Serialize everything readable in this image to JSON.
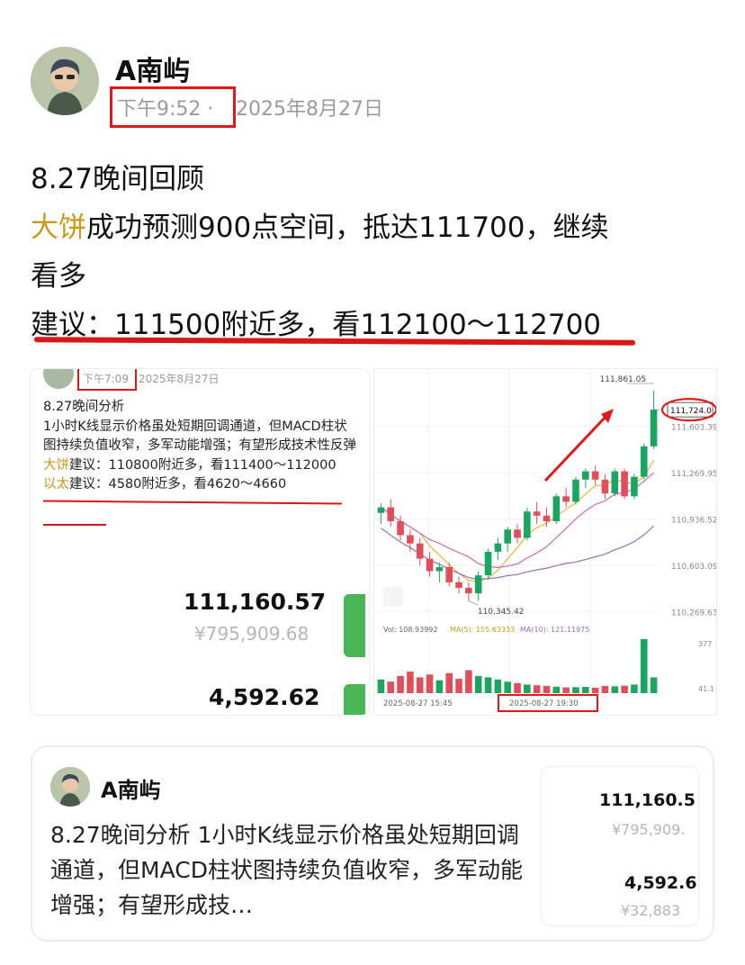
{
  "author": {
    "name": "A南屿"
  },
  "post_meta": {
    "time": "下午9:52",
    "separator": "·",
    "date": "2025年8月27日"
  },
  "post": {
    "line1": "8.27晚间回顾",
    "line2_highlight": "大饼",
    "line2_rest": "成功预测900点空间，抵达111700，继续",
    "line3": "看多",
    "line4": "建议：111500附近多，看112100～112700"
  },
  "embedded_left": {
    "time": "下午7:09",
    "date": "2025年8月27日",
    "title": "8.27晚间分析",
    "body": "1小时K线显示价格虽处短期回调通道，但MACD柱状图持续负值收窄，多军动能增强；有望形成技术性反弹",
    "btc_label": "大饼",
    "btc_advice": "建议：110800附近多，看111400～112000",
    "eth_label": "以太",
    "eth_advice": "建议：4580附近多，看4620～4660",
    "price1": "111,160.57",
    "price1_cny": "¥795,909.68",
    "price2": "4,592.62"
  },
  "chart_data": {
    "type": "candlestick",
    "price_axis_labels": [
      "111,603.39",
      "111,269.95",
      "110,936.52",
      "110,603.09",
      "110,269.63"
    ],
    "high_label": "111,861.05",
    "low_label": "110,345.42",
    "last_price_label": "111,724.0",
    "volume_info": {
      "vol": "Vol: 108.93992",
      "ma5": "MA(5): 155.63333",
      "ma10": "MA(10): 121.11975"
    },
    "volume_axis_labels": [
      "377",
      "41.1"
    ],
    "time_labels": [
      "2025-08-27 15:45",
      "2025-08-27 19:30"
    ],
    "candles": [
      {
        "o": 110980,
        "h": 111050,
        "l": 110900,
        "c": 111020
      },
      {
        "o": 111020,
        "h": 111080,
        "l": 110880,
        "c": 110920
      },
      {
        "o": 110920,
        "h": 110960,
        "l": 110780,
        "c": 110820
      },
      {
        "o": 110820,
        "h": 110860,
        "l": 110700,
        "c": 110760
      },
      {
        "o": 110760,
        "h": 110800,
        "l": 110600,
        "c": 110650
      },
      {
        "o": 110650,
        "h": 110700,
        "l": 110520,
        "c": 110560
      },
      {
        "o": 110560,
        "h": 110620,
        "l": 110480,
        "c": 110590
      },
      {
        "o": 110590,
        "h": 110620,
        "l": 110450,
        "c": 110480
      },
      {
        "o": 110480,
        "h": 110520,
        "l": 110400,
        "c": 110440
      },
      {
        "o": 110440,
        "h": 110480,
        "l": 110345,
        "c": 110400
      },
      {
        "o": 110400,
        "h": 110560,
        "l": 110345,
        "c": 110530
      },
      {
        "o": 110530,
        "h": 110720,
        "l": 110500,
        "c": 110700
      },
      {
        "o": 110700,
        "h": 110800,
        "l": 110640,
        "c": 110760
      },
      {
        "o": 110760,
        "h": 110880,
        "l": 110700,
        "c": 110860
      },
      {
        "o": 110860,
        "h": 110900,
        "l": 110760,
        "c": 110800
      },
      {
        "o": 110800,
        "h": 111020,
        "l": 110780,
        "c": 110990
      },
      {
        "o": 110990,
        "h": 111060,
        "l": 110900,
        "c": 110960
      },
      {
        "o": 110960,
        "h": 111020,
        "l": 110880,
        "c": 110920
      },
      {
        "o": 110920,
        "h": 111120,
        "l": 110900,
        "c": 111100
      },
      {
        "o": 111100,
        "h": 111160,
        "l": 111020,
        "c": 111060
      },
      {
        "o": 111060,
        "h": 111240,
        "l": 111040,
        "c": 111220
      },
      {
        "o": 111220,
        "h": 111300,
        "l": 111160,
        "c": 111280
      },
      {
        "o": 111280,
        "h": 111320,
        "l": 111180,
        "c": 111220
      },
      {
        "o": 111220,
        "h": 111260,
        "l": 111080,
        "c": 111120
      },
      {
        "o": 111120,
        "h": 111300,
        "l": 111100,
        "c": 111280
      },
      {
        "o": 111280,
        "h": 111300,
        "l": 111080,
        "c": 111100
      },
      {
        "o": 111100,
        "h": 111260,
        "l": 111080,
        "c": 111240
      },
      {
        "o": 111240,
        "h": 111480,
        "l": 111220,
        "c": 111460
      },
      {
        "o": 111460,
        "h": 111861,
        "l": 111440,
        "c": 111724
      }
    ],
    "volumes": [
      95,
      80,
      120,
      150,
      110,
      130,
      90,
      140,
      100,
      160,
      120,
      110,
      95,
      80,
      70,
      60,
      55,
      50,
      45,
      40,
      42,
      44,
      38,
      50,
      48,
      52,
      60,
      377,
      110
    ]
  },
  "quote_card": {
    "name": "A南屿",
    "text": "8.27晚间分析 1小时K线显示价格虽处短期回调通道，但MACD柱状图持续负值收窄，多军动能增强；有望形成技…",
    "price1": "111,160.5",
    "price1_cny": "¥795,909.",
    "price2": "4,592.6",
    "price2_cny": "¥32,883"
  },
  "colors": {
    "accent_gold": "#c9991a",
    "annotation_red": "#e01818",
    "up": "#1aa561",
    "down": "#e24d5a"
  }
}
